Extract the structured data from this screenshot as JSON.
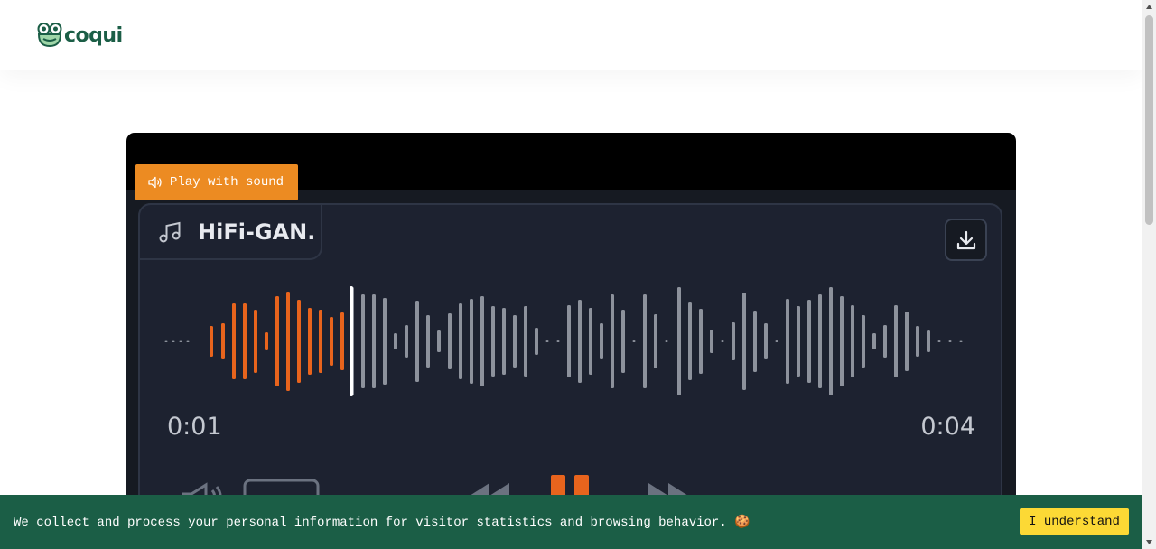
{
  "header": {
    "logo_text": "coqui",
    "logo_icon": "frog-icon"
  },
  "player": {
    "title": "HiFi-GAN.",
    "title_icon": "music-note-icon",
    "time_current": "0:01",
    "time_total": "0:04",
    "download_icon": "download-icon",
    "controls_icons": [
      "volume-icon",
      "speed-button",
      "rewind-icon",
      "pause-icon",
      "fast-forward-icon"
    ],
    "play_sound_label": "Play with sound",
    "played_color": "#e8641d",
    "unplayed_color": "#8d929c",
    "cursor_color": "#ffffff",
    "accent_button_color": "#ec8b22"
  },
  "cookie_banner": {
    "text": "We collect and process your personal information for visitor statistics and browsing behavior. 🍪",
    "button_label": "I understand",
    "background": "#1b5e46",
    "button_color": "#fcd935"
  }
}
